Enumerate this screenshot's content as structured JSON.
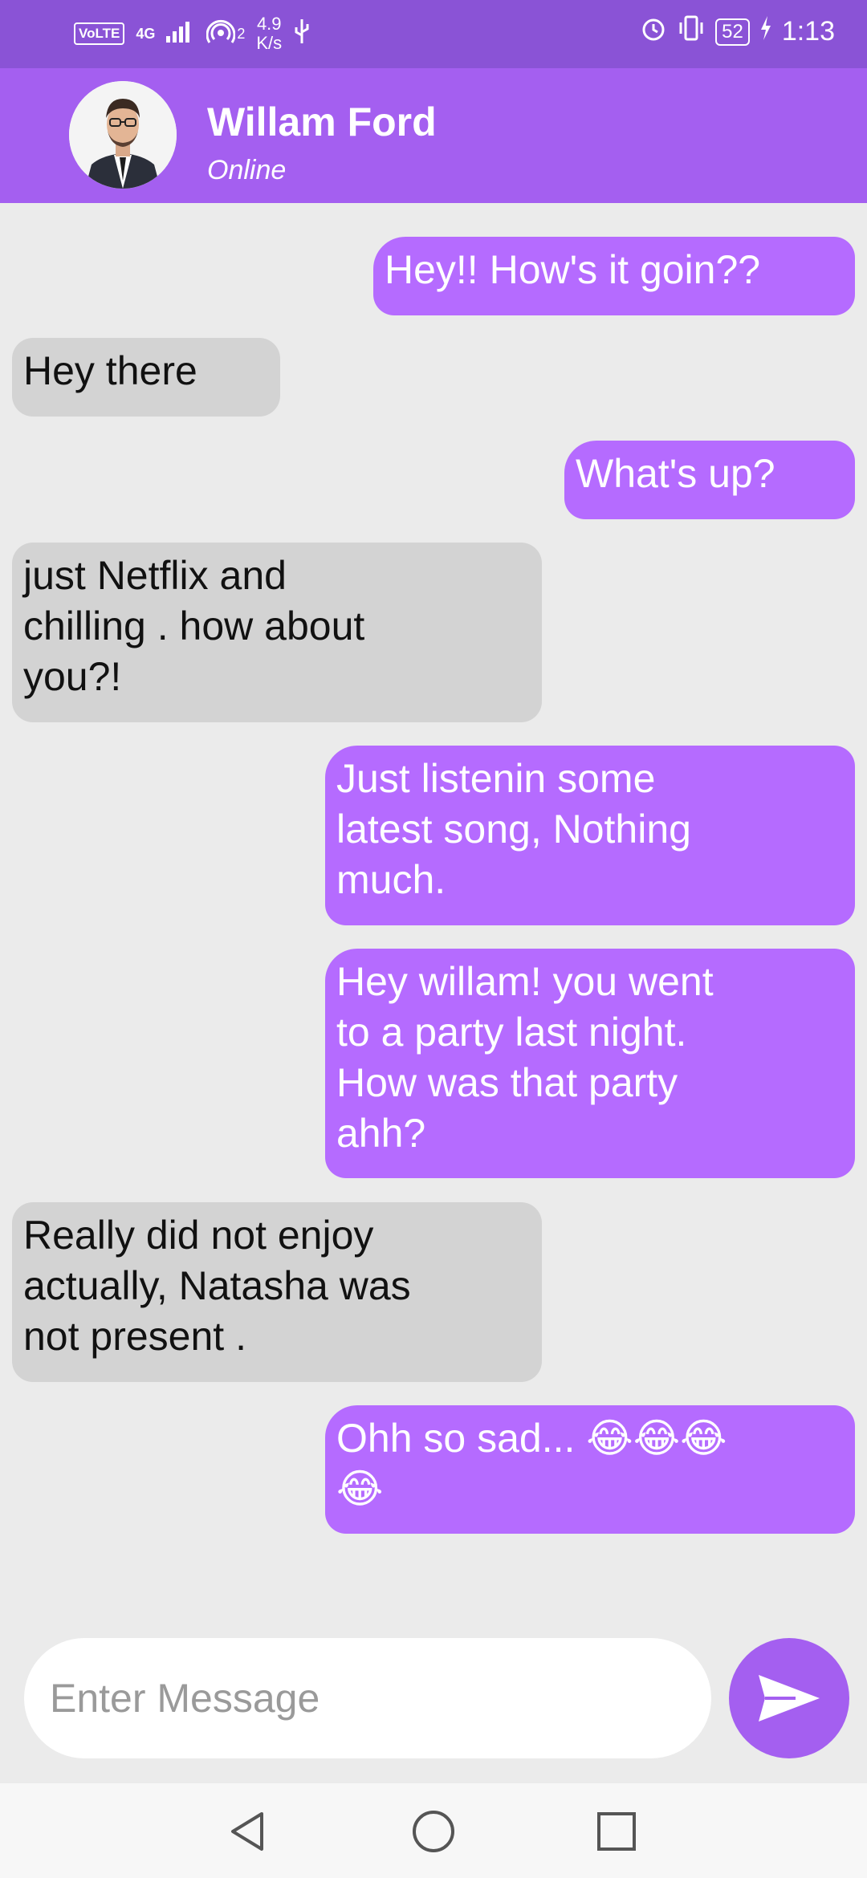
{
  "status_bar": {
    "volte": "VoLTE",
    "network": "4G",
    "hotspot_count": "2",
    "speed_value": "4.9",
    "speed_unit": "K/s",
    "battery": "52",
    "time": "1:13",
    "icons": [
      "signal-icon",
      "hotspot-icon",
      "usb-icon",
      "alarm-icon",
      "vibrate-icon",
      "battery-icon",
      "charging-icon"
    ]
  },
  "header": {
    "name": "Willam Ford",
    "status": "Online"
  },
  "messages": [
    {
      "from": "me",
      "text": "Hey!! How's it goin??"
    },
    {
      "from": "them",
      "text": "Hey there"
    },
    {
      "from": "me",
      "text": "What's up?"
    },
    {
      "from": "them",
      "text": "just Netflix and\nchilling . how about\nyou?!"
    },
    {
      "from": "me",
      "text": "Just listenin some\nlatest song, Nothing\nmuch."
    },
    {
      "from": "me",
      "text": "Hey willam! you went\nto a party last night.\nHow was that party\nahh?"
    },
    {
      "from": "them",
      "text": "Really did not enjoy\nactually, Natasha was\nnot present ."
    },
    {
      "from": "me",
      "text": "Ohh so sad... 😂😂😂\n😂"
    }
  ],
  "composer": {
    "placeholder": "Enter Message",
    "value": ""
  },
  "colors": {
    "status_bar": "#8a53d6",
    "header": "#a45ff0",
    "sent_bubble": "#b56bff",
    "received_bubble": "#d3d3d3",
    "background": "#ebebeb"
  }
}
